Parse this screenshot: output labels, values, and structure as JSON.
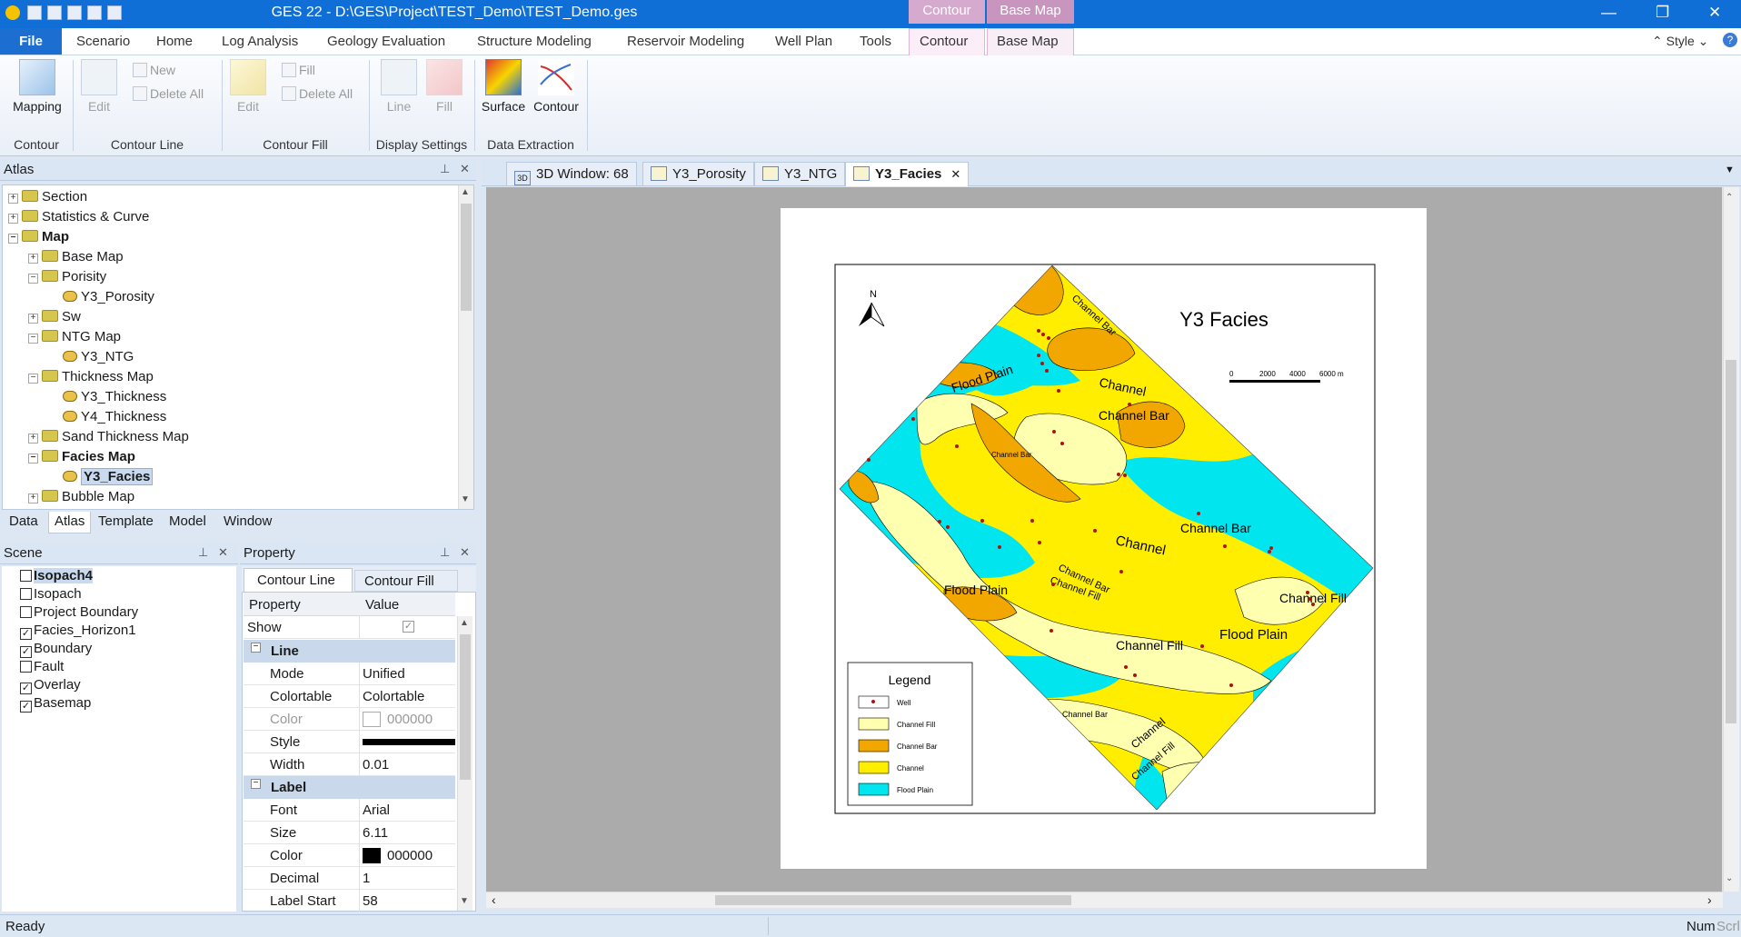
{
  "app": {
    "title": "GES 22 - D:\\GES\\Project\\TEST_Demo\\TEST_Demo.ges",
    "context_header_contour": "Contour",
    "context_header_basemap": "Base Map",
    "style_label": "Style"
  },
  "menu": {
    "file": "File",
    "items": [
      "Scenario",
      "Home",
      "Log Analysis",
      "Geology Evaluation",
      "Structure Modeling",
      "Reservoir Modeling",
      "Well Plan",
      "Tools",
      "Contour",
      "Base Map"
    ]
  },
  "ribbon": {
    "mapping": "Mapping",
    "line_edit": "Edit",
    "line_new": "New",
    "line_delete_all": "Delete All",
    "fill_edit": "Edit",
    "fill_fill": "Fill",
    "fill_delete_all": "Delete All",
    "display_line": "Line",
    "display_fill": "Fill",
    "surface": "Surface",
    "contour": "Contour",
    "groups": [
      "Contour",
      "Contour Line",
      "Contour Fill",
      "Display Settings",
      "Data Extraction"
    ]
  },
  "atlas": {
    "title": "Atlas",
    "items": [
      "Section",
      "Statistics & Curve",
      "Map",
      "Base Map",
      "Porisity",
      "Y3_Porosity",
      "Sw",
      "NTG Map",
      "Y3_NTG",
      "Thickness Map",
      "Y3_Thickness",
      "Y4_Thickness",
      "Sand Thickness Map",
      "Facies Map",
      "Y3_Facies",
      "Bubble Map"
    ]
  },
  "bottom_tabs": [
    "Data",
    "Atlas",
    "Template",
    "Model",
    "Window"
  ],
  "scene": {
    "title": "Scene",
    "items": [
      {
        "label": "Isopach4",
        "checked": false
      },
      {
        "label": "Isopach",
        "checked": false
      },
      {
        "label": "Project Boundary",
        "checked": false
      },
      {
        "label": "Facies_Horizon1",
        "checked": true
      },
      {
        "label": "Boundary",
        "checked": true
      },
      {
        "label": "Fault",
        "checked": false
      },
      {
        "label": "Overlay",
        "checked": true
      },
      {
        "label": "Basemap",
        "checked": true
      }
    ]
  },
  "property": {
    "title": "Property",
    "tab_line": "Contour Line",
    "tab_fill": "Contour Fill",
    "col_property": "Property",
    "col_value": "Value",
    "show": "Show",
    "cat_line": "Line",
    "mode": "Mode",
    "mode_val": "Unified",
    "colortable": "Colortable",
    "colortable_val": "Colortable",
    "color": "Color",
    "color_val": "000000",
    "style": "Style",
    "width": "Width",
    "width_val": "0.01",
    "cat_label": "Label",
    "font": "Font",
    "font_val": "Arial",
    "size": "Size",
    "size_val": "6.11",
    "label_color": "Color",
    "label_color_val": "000000",
    "decimal": "Decimal",
    "decimal_val": "1",
    "label_start": "Label Start",
    "label_start_val": "58"
  },
  "doc_tabs": [
    "3D Window: 68",
    "Y3_Porosity",
    "Y3_NTG",
    "Y3_Facies"
  ],
  "map": {
    "title": "Y3 Facies",
    "north": "N",
    "scale_ticks": [
      "0",
      "2000",
      "4000",
      "6000 m"
    ],
    "legend_title": "Legend",
    "legend_items": [
      {
        "label": "Well",
        "color": "#ffffff"
      },
      {
        "label": "Channel Fill",
        "color": "#ffffb0"
      },
      {
        "label": "Channel Bar",
        "color": "#f2a600"
      },
      {
        "label": "Channel",
        "color": "#ffee00"
      },
      {
        "label": "Flood Plain",
        "color": "#00e5ee"
      }
    ],
    "labels": {
      "channel_bar": "Channel Bar",
      "channel": "Channel",
      "flood_plain": "Flood  Plain",
      "channel_fill": "Channel Fill"
    }
  },
  "status": {
    "ready": "Ready",
    "num": "Num",
    "scrl": "Scrl"
  },
  "colors": {
    "channel_fill": "#ffffb0",
    "channel_bar": "#f2a600",
    "channel": "#ffee00",
    "flood_plain": "#00e5ee"
  }
}
